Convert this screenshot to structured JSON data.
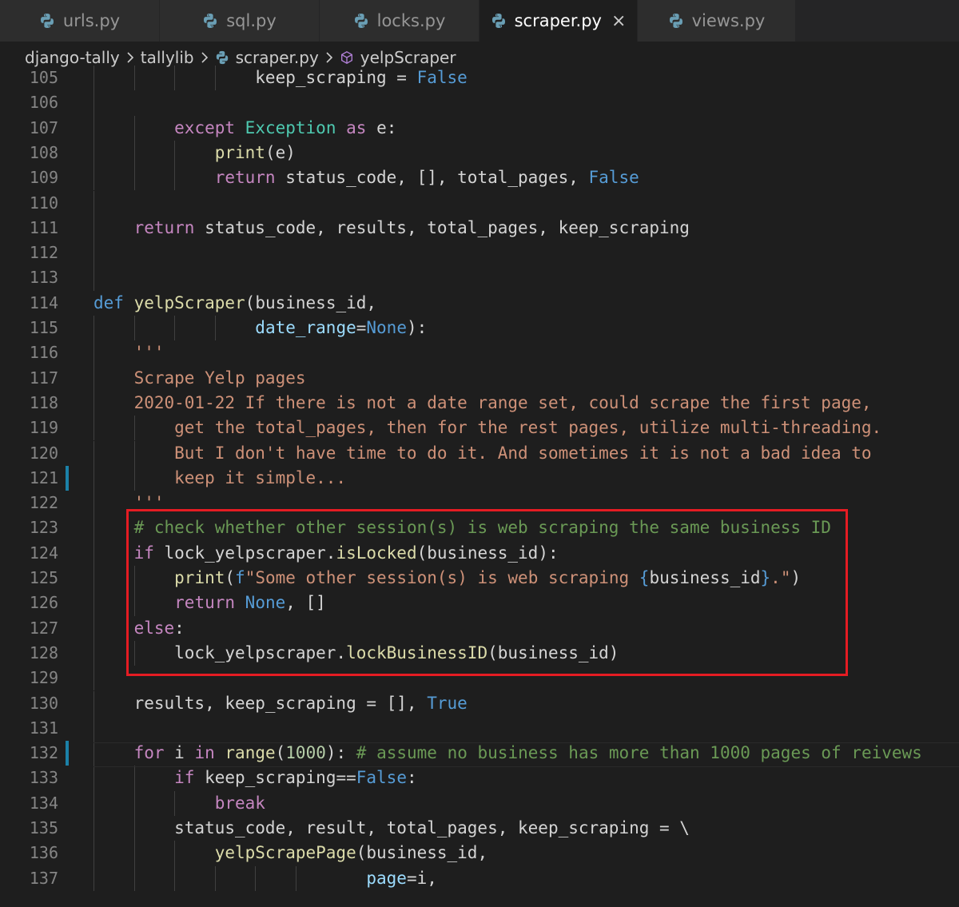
{
  "tabs": [
    {
      "label": "urls.py",
      "active": false,
      "width": 0
    },
    {
      "label": "sql.py",
      "active": false
    },
    {
      "label": "locks.py",
      "active": false
    },
    {
      "label": "scraper.py",
      "active": true
    },
    {
      "label": "views.py",
      "active": false
    }
  ],
  "tab_close_glyph": "×",
  "breadcrumb": {
    "items": [
      "django-tally",
      "tallylib",
      "scraper.py",
      "yelpScraper"
    ]
  },
  "editor": {
    "lines": [
      {
        "n": "105",
        "text": "                keep_scraping = False"
      },
      {
        "n": "106",
        "text": ""
      },
      {
        "n": "107",
        "text": "        except Exception as e:"
      },
      {
        "n": "108",
        "text": "            print(e)"
      },
      {
        "n": "109",
        "text": "            return status_code, [], total_pages, False"
      },
      {
        "n": "110",
        "text": ""
      },
      {
        "n": "111",
        "text": "    return status_code, results, total_pages, keep_scraping"
      },
      {
        "n": "112",
        "text": ""
      },
      {
        "n": "113",
        "text": ""
      },
      {
        "n": "114",
        "text": "def yelpScraper(business_id,"
      },
      {
        "n": "115",
        "text": "                date_range=None):"
      },
      {
        "n": "116",
        "text": "    '''"
      },
      {
        "n": "117",
        "text": "    Scrape Yelp pages"
      },
      {
        "n": "118",
        "text": "    2020-01-22 If there is not a date range set, could scrape the first page,"
      },
      {
        "n": "119",
        "text": "        get the total_pages, then for the rest pages, utilize multi-threading."
      },
      {
        "n": "120",
        "text": "        But I don't have time to do it. And sometimes it is not a bad idea to"
      },
      {
        "n": "121",
        "text": "        keep it simple..."
      },
      {
        "n": "122",
        "text": "    '''"
      },
      {
        "n": "123",
        "text": "    # check whether other session(s) is web scraping the same business ID"
      },
      {
        "n": "124",
        "text": "    if lock_yelpscraper.isLocked(business_id):"
      },
      {
        "n": "125",
        "text": "        print(f\"Some other session(s) is web scraping {business_id}.\")"
      },
      {
        "n": "126",
        "text": "        return None, []"
      },
      {
        "n": "127",
        "text": "    else:"
      },
      {
        "n": "128",
        "text": "        lock_yelpscraper.lockBusinessID(business_id)"
      },
      {
        "n": "129",
        "text": ""
      },
      {
        "n": "130",
        "text": "    results, keep_scraping = [], True"
      },
      {
        "n": "131",
        "text": ""
      },
      {
        "n": "132",
        "text": "    for i in range(1000): # assume no business has more than 1000 pages of reivews"
      },
      {
        "n": "133",
        "text": "        if keep_scraping==False:"
      },
      {
        "n": "134",
        "text": "            break"
      },
      {
        "n": "135",
        "text": "        status_code, result, total_pages, keep_scraping = \\"
      },
      {
        "n": "136",
        "text": "            yelpScrapePage(business_id,"
      },
      {
        "n": "137",
        "text": "                           page=i,"
      }
    ],
    "modified_lines": [
      "121",
      "132"
    ]
  },
  "colors": {
    "background": "#1e1e1e",
    "keyword": "#c586c0",
    "builtin_constant": "#569cd6",
    "class": "#4ec9b0",
    "function": "#dcdcaa",
    "parameter": "#9cdcfe",
    "string": "#ce9178",
    "comment": "#6a9955",
    "number": "#b5cea8",
    "highlight_box": "#e51c23"
  },
  "icons": {
    "tab": "python-icon",
    "breadcrumb_separator": "chevron-right-icon",
    "symbol": "method-cube-icon"
  }
}
